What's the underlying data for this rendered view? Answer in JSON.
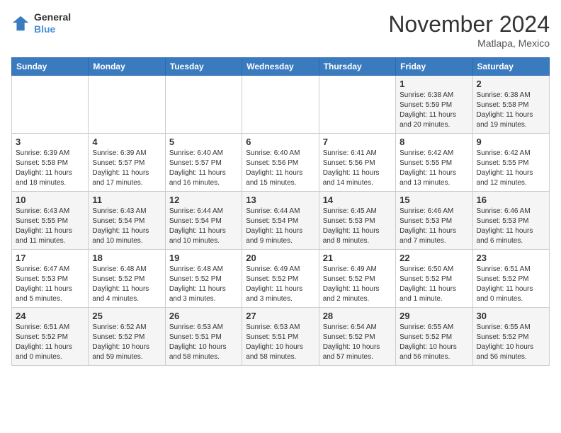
{
  "header": {
    "logo_line1": "General",
    "logo_line2": "Blue",
    "month": "November 2024",
    "location": "Matlapa, Mexico"
  },
  "days_of_week": [
    "Sunday",
    "Monday",
    "Tuesday",
    "Wednesday",
    "Thursday",
    "Friday",
    "Saturday"
  ],
  "weeks": [
    [
      {
        "day": "",
        "info": ""
      },
      {
        "day": "",
        "info": ""
      },
      {
        "day": "",
        "info": ""
      },
      {
        "day": "",
        "info": ""
      },
      {
        "day": "",
        "info": ""
      },
      {
        "day": "1",
        "info": "Sunrise: 6:38 AM\nSunset: 5:59 PM\nDaylight: 11 hours\nand 20 minutes."
      },
      {
        "day": "2",
        "info": "Sunrise: 6:38 AM\nSunset: 5:58 PM\nDaylight: 11 hours\nand 19 minutes."
      }
    ],
    [
      {
        "day": "3",
        "info": "Sunrise: 6:39 AM\nSunset: 5:58 PM\nDaylight: 11 hours\nand 18 minutes."
      },
      {
        "day": "4",
        "info": "Sunrise: 6:39 AM\nSunset: 5:57 PM\nDaylight: 11 hours\nand 17 minutes."
      },
      {
        "day": "5",
        "info": "Sunrise: 6:40 AM\nSunset: 5:57 PM\nDaylight: 11 hours\nand 16 minutes."
      },
      {
        "day": "6",
        "info": "Sunrise: 6:40 AM\nSunset: 5:56 PM\nDaylight: 11 hours\nand 15 minutes."
      },
      {
        "day": "7",
        "info": "Sunrise: 6:41 AM\nSunset: 5:56 PM\nDaylight: 11 hours\nand 14 minutes."
      },
      {
        "day": "8",
        "info": "Sunrise: 6:42 AM\nSunset: 5:55 PM\nDaylight: 11 hours\nand 13 minutes."
      },
      {
        "day": "9",
        "info": "Sunrise: 6:42 AM\nSunset: 5:55 PM\nDaylight: 11 hours\nand 12 minutes."
      }
    ],
    [
      {
        "day": "10",
        "info": "Sunrise: 6:43 AM\nSunset: 5:55 PM\nDaylight: 11 hours\nand 11 minutes."
      },
      {
        "day": "11",
        "info": "Sunrise: 6:43 AM\nSunset: 5:54 PM\nDaylight: 11 hours\nand 10 minutes."
      },
      {
        "day": "12",
        "info": "Sunrise: 6:44 AM\nSunset: 5:54 PM\nDaylight: 11 hours\nand 10 minutes."
      },
      {
        "day": "13",
        "info": "Sunrise: 6:44 AM\nSunset: 5:54 PM\nDaylight: 11 hours\nand 9 minutes."
      },
      {
        "day": "14",
        "info": "Sunrise: 6:45 AM\nSunset: 5:53 PM\nDaylight: 11 hours\nand 8 minutes."
      },
      {
        "day": "15",
        "info": "Sunrise: 6:46 AM\nSunset: 5:53 PM\nDaylight: 11 hours\nand 7 minutes."
      },
      {
        "day": "16",
        "info": "Sunrise: 6:46 AM\nSunset: 5:53 PM\nDaylight: 11 hours\nand 6 minutes."
      }
    ],
    [
      {
        "day": "17",
        "info": "Sunrise: 6:47 AM\nSunset: 5:53 PM\nDaylight: 11 hours\nand 5 minutes."
      },
      {
        "day": "18",
        "info": "Sunrise: 6:48 AM\nSunset: 5:52 PM\nDaylight: 11 hours\nand 4 minutes."
      },
      {
        "day": "19",
        "info": "Sunrise: 6:48 AM\nSunset: 5:52 PM\nDaylight: 11 hours\nand 3 minutes."
      },
      {
        "day": "20",
        "info": "Sunrise: 6:49 AM\nSunset: 5:52 PM\nDaylight: 11 hours\nand 3 minutes."
      },
      {
        "day": "21",
        "info": "Sunrise: 6:49 AM\nSunset: 5:52 PM\nDaylight: 11 hours\nand 2 minutes."
      },
      {
        "day": "22",
        "info": "Sunrise: 6:50 AM\nSunset: 5:52 PM\nDaylight: 11 hours\nand 1 minute."
      },
      {
        "day": "23",
        "info": "Sunrise: 6:51 AM\nSunset: 5:52 PM\nDaylight: 11 hours\nand 0 minutes."
      }
    ],
    [
      {
        "day": "24",
        "info": "Sunrise: 6:51 AM\nSunset: 5:52 PM\nDaylight: 11 hours\nand 0 minutes."
      },
      {
        "day": "25",
        "info": "Sunrise: 6:52 AM\nSunset: 5:52 PM\nDaylight: 10 hours\nand 59 minutes."
      },
      {
        "day": "26",
        "info": "Sunrise: 6:53 AM\nSunset: 5:51 PM\nDaylight: 10 hours\nand 58 minutes."
      },
      {
        "day": "27",
        "info": "Sunrise: 6:53 AM\nSunset: 5:51 PM\nDaylight: 10 hours\nand 58 minutes."
      },
      {
        "day": "28",
        "info": "Sunrise: 6:54 AM\nSunset: 5:52 PM\nDaylight: 10 hours\nand 57 minutes."
      },
      {
        "day": "29",
        "info": "Sunrise: 6:55 AM\nSunset: 5:52 PM\nDaylight: 10 hours\nand 56 minutes."
      },
      {
        "day": "30",
        "info": "Sunrise: 6:55 AM\nSunset: 5:52 PM\nDaylight: 10 hours\nand 56 minutes."
      }
    ]
  ]
}
